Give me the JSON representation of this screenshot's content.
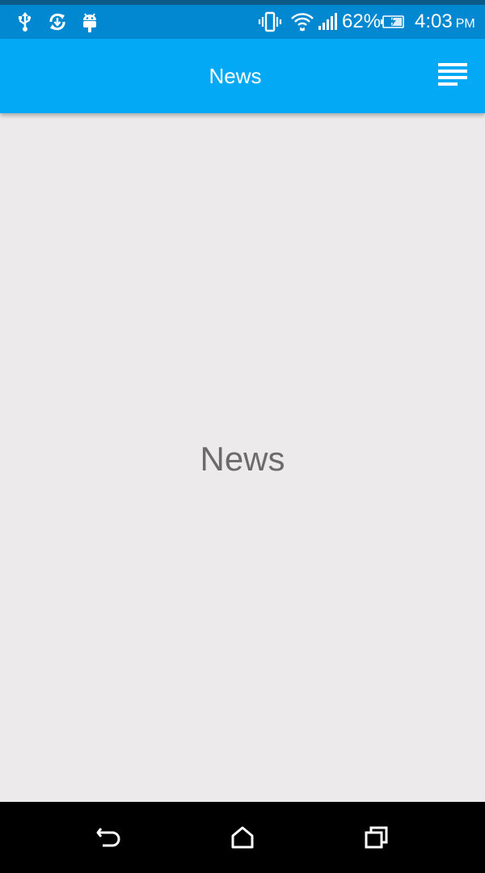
{
  "status_bar": {
    "icons": [
      "usb-icon",
      "sync-icon",
      "android-debug-icon",
      "vibrate-icon",
      "wifi-icon",
      "signal-icon",
      "battery-charging-icon"
    ],
    "battery_percent": "62%",
    "time": "4:03",
    "ampm": "PM",
    "colors": {
      "background": "#0288d1"
    }
  },
  "app_bar": {
    "title": "News",
    "menu_icon": "menu-lines-icon",
    "colors": {
      "background": "#03a9f4"
    }
  },
  "content": {
    "label": "News",
    "colors": {
      "background": "#eceaea",
      "text": "#6c6a6a"
    }
  },
  "nav_bar": {
    "icons": [
      "back-icon",
      "home-icon",
      "recents-icon"
    ]
  }
}
